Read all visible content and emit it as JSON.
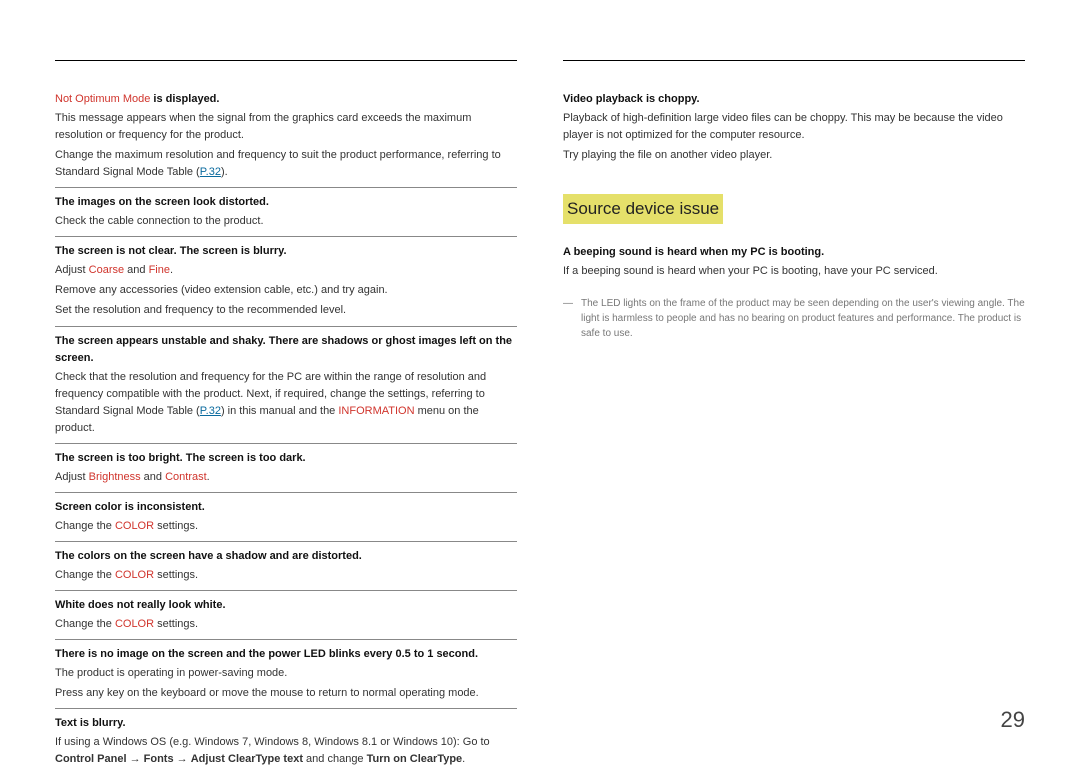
{
  "page_number": "29",
  "left": {
    "items": [
      {
        "q_parts": [
          {
            "text": "Not Optimum Mode",
            "style": "red"
          },
          {
            "text": " is displayed.",
            "style": "plain"
          }
        ],
        "a": [
          {
            "parts": [
              {
                "text": "This message appears when the signal from the graphics card exceeds the maximum resolution or frequency for the product.",
                "style": "plain"
              }
            ]
          },
          {
            "parts": [
              {
                "text": "Change the maximum resolution and frequency to suit the product performance, referring to Standard Signal Mode Table (",
                "style": "plain"
              },
              {
                "text": "P.32",
                "style": "link"
              },
              {
                "text": ").",
                "style": "plain"
              }
            ]
          }
        ]
      },
      {
        "q_parts": [
          {
            "text": "The images on the screen look distorted.",
            "style": "plain"
          }
        ],
        "a": [
          {
            "parts": [
              {
                "text": "Check the cable connection to the product.",
                "style": "plain"
              }
            ]
          }
        ]
      },
      {
        "q_parts": [
          {
            "text": "The screen is not clear. The screen is blurry.",
            "style": "plain"
          }
        ],
        "a": [
          {
            "parts": [
              {
                "text": "Adjust ",
                "style": "plain"
              },
              {
                "text": "Coarse",
                "style": "red"
              },
              {
                "text": " and ",
                "style": "plain"
              },
              {
                "text": "Fine",
                "style": "red"
              },
              {
                "text": ".",
                "style": "plain"
              }
            ]
          },
          {
            "parts": [
              {
                "text": "Remove any accessories (video extension cable, etc.) and try again.",
                "style": "plain"
              }
            ]
          },
          {
            "parts": [
              {
                "text": "Set the resolution and frequency to the recommended level.",
                "style": "plain"
              }
            ]
          }
        ]
      },
      {
        "q_parts": [
          {
            "text": "The screen appears unstable and shaky. There are shadows or ghost images left on the screen.",
            "style": "plain"
          }
        ],
        "a": [
          {
            "parts": [
              {
                "text": "Check that the resolution and frequency for the PC are within the range of resolution and frequency compatible with the product. Next, if required, change the settings, referring to Standard Signal Mode Table (",
                "style": "plain"
              },
              {
                "text": "P.32",
                "style": "link"
              },
              {
                "text": ") in this manual and the ",
                "style": "plain"
              },
              {
                "text": "INFORMATION",
                "style": "red"
              },
              {
                "text": " menu on the product.",
                "style": "plain"
              }
            ]
          }
        ]
      },
      {
        "q_parts": [
          {
            "text": "The screen is too bright. The screen is too dark.",
            "style": "plain"
          }
        ],
        "a": [
          {
            "parts": [
              {
                "text": "Adjust ",
                "style": "plain"
              },
              {
                "text": "Brightness",
                "style": "red"
              },
              {
                "text": " and ",
                "style": "plain"
              },
              {
                "text": "Contrast",
                "style": "red"
              },
              {
                "text": ".",
                "style": "plain"
              }
            ]
          }
        ]
      },
      {
        "q_parts": [
          {
            "text": "Screen color is inconsistent.",
            "style": "plain"
          }
        ],
        "a": [
          {
            "parts": [
              {
                "text": "Change the ",
                "style": "plain"
              },
              {
                "text": "COLOR",
                "style": "red"
              },
              {
                "text": " settings.",
                "style": "plain"
              }
            ]
          }
        ]
      },
      {
        "q_parts": [
          {
            "text": "The colors on the screen have a shadow and are distorted.",
            "style": "plain"
          }
        ],
        "a": [
          {
            "parts": [
              {
                "text": "Change the ",
                "style": "plain"
              },
              {
                "text": "COLOR",
                "style": "red"
              },
              {
                "text": " settings.",
                "style": "plain"
              }
            ]
          }
        ]
      },
      {
        "q_parts": [
          {
            "text": "White does not really look white.",
            "style": "plain"
          }
        ],
        "a": [
          {
            "parts": [
              {
                "text": "Change the ",
                "style": "plain"
              },
              {
                "text": "COLOR",
                "style": "red"
              },
              {
                "text": " settings.",
                "style": "plain"
              }
            ]
          }
        ]
      },
      {
        "q_parts": [
          {
            "text": "There is no image on the screen and the power LED blinks every 0.5 to 1 second.",
            "style": "plain"
          }
        ],
        "a": [
          {
            "parts": [
              {
                "text": "The product is operating in power-saving mode.",
                "style": "plain"
              }
            ]
          },
          {
            "parts": [
              {
                "text": "Press any key on the keyboard or move the mouse to return to normal operating mode.",
                "style": "plain"
              }
            ]
          }
        ]
      },
      {
        "q_parts": [
          {
            "text": "Text is blurry.",
            "style": "plain"
          }
        ],
        "a": [
          {
            "parts": [
              {
                "text": "If using a Windows OS (e.g. Windows 7, Windows 8, Windows 8.1 or Windows 10): Go to ",
                "style": "plain"
              },
              {
                "text": "Control Panel",
                "style": "bold"
              },
              {
                "text": " → ",
                "style": "arrow"
              },
              {
                "text": "Fonts",
                "style": "bold"
              },
              {
                "text": " → ",
                "style": "arrow"
              },
              {
                "text": "Adjust ClearType text",
                "style": "bold"
              },
              {
                "text": " and change ",
                "style": "plain"
              },
              {
                "text": "Turn on ClearType",
                "style": "bold"
              },
              {
                "text": ".",
                "style": "plain"
              }
            ]
          }
        ],
        "no_border": true
      }
    ]
  },
  "right": {
    "top_items": [
      {
        "q_parts": [
          {
            "text": "Video playback is choppy.",
            "style": "plain"
          }
        ],
        "a": [
          {
            "parts": [
              {
                "text": "Playback of high-definition large video files can be choppy. This may be because the video player is not optimized for the computer resource.",
                "style": "plain"
              }
            ]
          },
          {
            "parts": [
              {
                "text": "Try playing the file on another video player.",
                "style": "plain"
              }
            ]
          }
        ],
        "no_border": true
      }
    ],
    "section_title": "Source device issue",
    "section_items": [
      {
        "q_parts": [
          {
            "text": "A beeping sound is heard when my PC is booting.",
            "style": "plain"
          }
        ],
        "a": [
          {
            "parts": [
              {
                "text": "If a beeping sound is heard when your PC is booting, have your PC serviced.",
                "style": "plain"
              }
            ]
          }
        ],
        "no_border": true
      }
    ],
    "footnote": "The LED lights on the frame of the product may be seen depending on the user's viewing angle. The light is harmless to people and has no bearing on product features and performance. The product is safe to use."
  }
}
